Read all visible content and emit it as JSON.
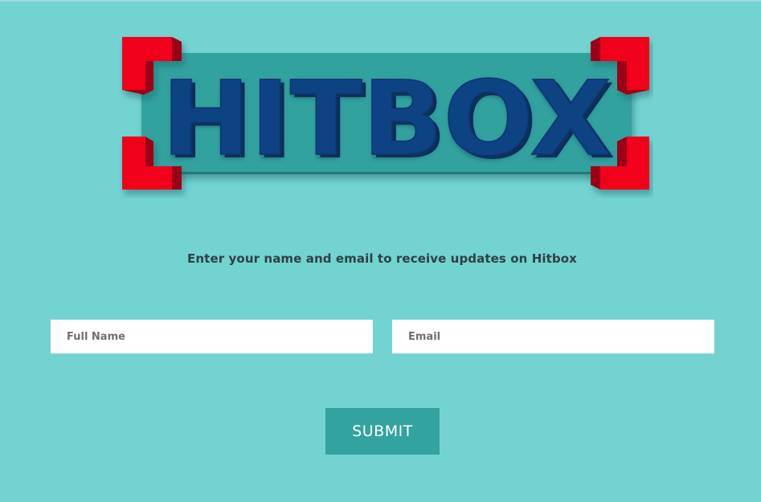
{
  "brand": {
    "logo_text": "HITBOX",
    "colors": {
      "background": "#72d3d1",
      "logo_panel": "#33a29f",
      "logo_text": "#0a4283",
      "logo_text_shadow": "#06295a",
      "brackets": "#f1001b",
      "brackets_side": "#9b0012",
      "button": "#32a39e"
    }
  },
  "signup": {
    "tagline": "Enter your name and email to receive updates on Hitbox",
    "name_placeholder": "Full Name",
    "email_placeholder": "Email",
    "submit_label": "SUBMIT"
  }
}
